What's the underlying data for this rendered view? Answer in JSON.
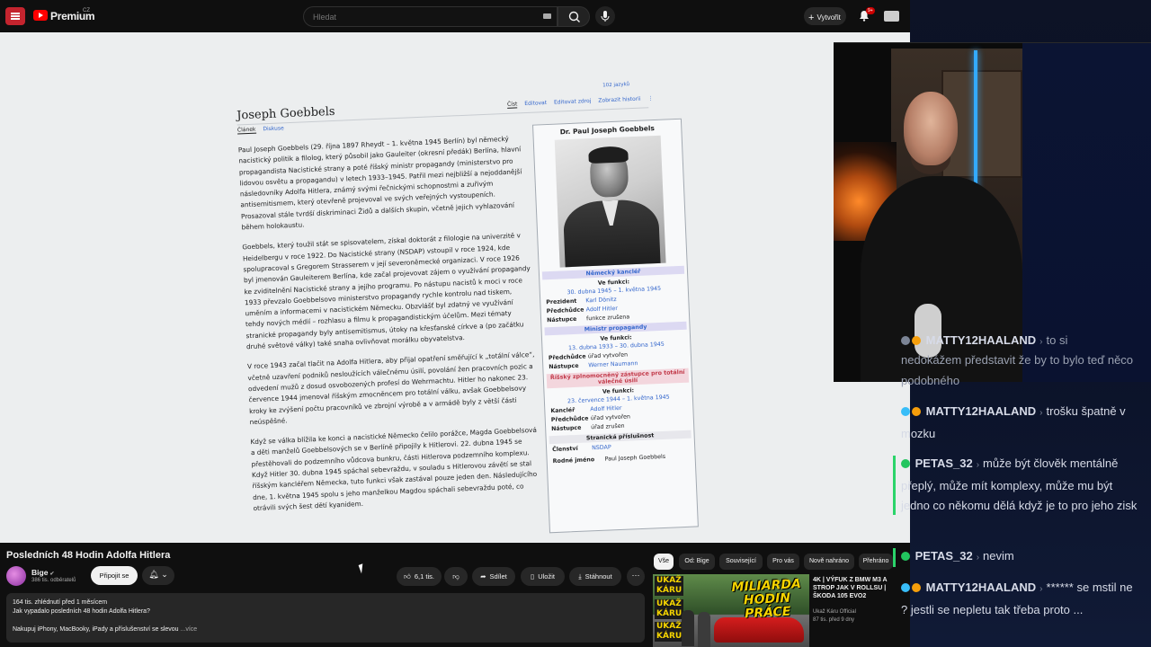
{
  "youtube": {
    "brand": "Premium",
    "country": "CZ",
    "search_placeholder": "Hledat",
    "create_label": "Vytvořit",
    "notif_count": "9+"
  },
  "wiki": {
    "lang_count": "102 jazyků",
    "title": "Joseph Goebbels",
    "tab_article": "Článek",
    "tab_discussion": "Diskuse",
    "actions": [
      "Číst",
      "Editovat",
      "Editovat zdroj",
      "Zobrazit historii"
    ],
    "paragraphs": {
      "p1": "Paul Joseph Goebbels (29. října 1897 Rheydt – 1. května 1945 Berlín) byl německý nacistický politik a filolog, který působil jako Gauleiter (okresní předák) Berlína, hlavní propagandista Nacistické strany a poté říšský ministr propagandy (ministerstvo pro lidovou osvětu a propagandu) v letech 1933–1945. Patřil mezi nejbližší a nejoddanější následovníky Adolfa Hitlera, známý svými řečnickými schopnostmi a zuřivým antisemitismem, který otevřeně projevoval ve svých veřejných vystoupeních. Prosazoval stále tvrdší diskriminaci Židů a dalších skupin, včetně jejich vyhlazování během holokaustu.",
      "p2": "Goebbels, který toužil stát se spisovatelem, získal doktorát z filologie na univerzitě v Heidelbergu v roce 1922. Do Nacistické strany (NSDAP) vstoupil v roce 1924, kde spolupracoval s Gregorem Strasserem v její severoněmecké organizaci. V roce 1926 byl jmenován Gauleiterem Berlína, kde začal projevovat zájem o využívání propagandy ke zviditelnění Nacistické strany a jejího programu. Po nástupu nacistů k moci v roce 1933 převzalo Goebbelsovo ministerstvo propagandy rychle kontrolu nad tiskem, uměním a informacemi v nacistickém Německu. Obzvlášť byl zdatný ve využívání tehdy nových médií – rozhlasu a filmu k propagandistickým účelům. Mezi tématy stranické propagandy byly antisemitismus, útoky na křesťanské církve a (po začátku druhé světové války) také snaha ovlivňovat morálku obyvatelstva.",
      "p3": "V roce 1943 začal tlačit na Adolfa Hitlera, aby přijal opatření směřující k „totální válce“, včetně uzavření podniků nesloužících válečnému úsilí, povolání žen pracovních pozic a odvedení mužů z dosud osvobozených profesí do Wehrmachtu. Hitler ho nakonec 23. července 1944 jmenoval říšským zmocněncem pro totální válku, avšak Goebbelsovy kroky ke zvýšení počtu pracovníků ve zbrojní výrobě a v armádě byly z větší části neúspěšné.",
      "p4": "Když se válka blížila ke konci a nacistické Německo čelilo porážce, Magda Goebbelsová a děti manželů Goebbelsových se v Berlíně připojily k Hitlerovi. 22. dubna 1945 se přestěhovali do podzemního vůdcova bunkru, části Hitlerova podzemního komplexu. Když Hitler 30. dubna 1945 spáchal sebevraždu, v souladu s Hitlerovou závětí se stal říšským kancléřem Německa, tuto funkci však zastával pouze jeden den. Následujícího dne, 1. května 1945 spolu s jeho manželkou Magdou spáchali sebevraždu poté, co otrávili svých šest dětí kyanidem."
    },
    "infobox": {
      "name": "Dr. Paul Joseph Goebbels",
      "sec1": "Německý kancléř",
      "ve_funkci": "Ve funkci:",
      "sec1_dates": "30. dubna 1945 – 1. května 1945",
      "rows1": [
        {
          "k": "Prezident",
          "v": "Karl Dönitz"
        },
        {
          "k": "Předchůdce",
          "v": "Adolf Hitler"
        },
        {
          "k": "Nástupce",
          "v": "funkce zrušena"
        }
      ],
      "sec2": "Ministr propagandy",
      "sec2_dates": "13. dubna 1933 – 30. dubna 1945",
      "rows2": [
        {
          "k": "Předchůdce",
          "v": "úřad vytvořen"
        },
        {
          "k": "Nástupce",
          "v": "Werner Naumann"
        }
      ],
      "sec3": "Říšský zplnomocněný zástupce pro totální válečné úsilí",
      "sec3_dates": "23. července 1944 – 1. května 1945",
      "rows3": [
        {
          "k": "Kancléř",
          "v": "Adolf Hitler"
        },
        {
          "k": "Předchůdce",
          "v": "úřad vytvořen"
        },
        {
          "k": "Nástupce",
          "v": "úřad zrušen"
        }
      ],
      "sec4": "Stranická příslušnost",
      "rows4": [
        {
          "k": "Členství",
          "v": "NSDAP"
        }
      ],
      "birth_k": "Rodné jméno",
      "birth_v": "Paul Joseph Goebbels"
    }
  },
  "video": {
    "title": "Posledních 48 Hodin Adolfa Hitlera",
    "channel": "Bige",
    "subs": "386 tis. odběratelů",
    "join": "Připojit se",
    "likes": "6,1 tis.",
    "share": "Sdílet",
    "save": "Uložit",
    "download": "Stáhnout",
    "views": "164 tis. zhlédnutí  před 1 měsícem",
    "desc1": "Jak vypadalo posledních 48 hodin Adolfa Hitlera?",
    "desc2": "Nakupuj iPhony, MacBooky, iPady a příslušenství se slevou",
    "more": "...více"
  },
  "chips": [
    "Vše",
    "Od: Bige",
    "Související",
    "Pro vás",
    "Nově nahráno",
    "Přehráno"
  ],
  "recommended": {
    "thumb_small": [
      "UKAŽ",
      "KÁRU",
      "UKAŽ",
      "KÁRU",
      "UKAŽ",
      "KÁRU"
    ],
    "thumb_big": "MILIARDA HODIN PRÁCE",
    "title": "4K | VÝFUK Z BMW M3 A STROP JAK V ROLLSU | ŠKODA 105 EVO2",
    "channel": "Ukaž Káru Official",
    "meta": "87 tis.   před 9 dny"
  },
  "chat": [
    {
      "user": "MATTY12HAALAND",
      "text": "to si"
    },
    {
      "user": "",
      "text": "nedokážem představit že by to bylo teď něco podobného"
    },
    {
      "user": "MATTY12HAALAND",
      "text": "trošku špatně v mozku"
    },
    {
      "user": "PETAS_32",
      "text": "může být člověk mentálně přeplý, může mít komplexy, může mu být jedno co někomu dělá když je to pro jeho zisk"
    },
    {
      "user": "PETAS_32",
      "text": "nevim"
    },
    {
      "user": "MATTY12HAALAND",
      "text": "****** se mstil ne ? jestli se nepletu tak třeba proto ..."
    }
  ],
  "colors": {
    "yt_bg": "#0f0f0f",
    "yt_red": "#ff0000",
    "wiki_link": "#3366cc",
    "chat_bg": "#0d1326",
    "chat_green": "#2bd46a"
  }
}
